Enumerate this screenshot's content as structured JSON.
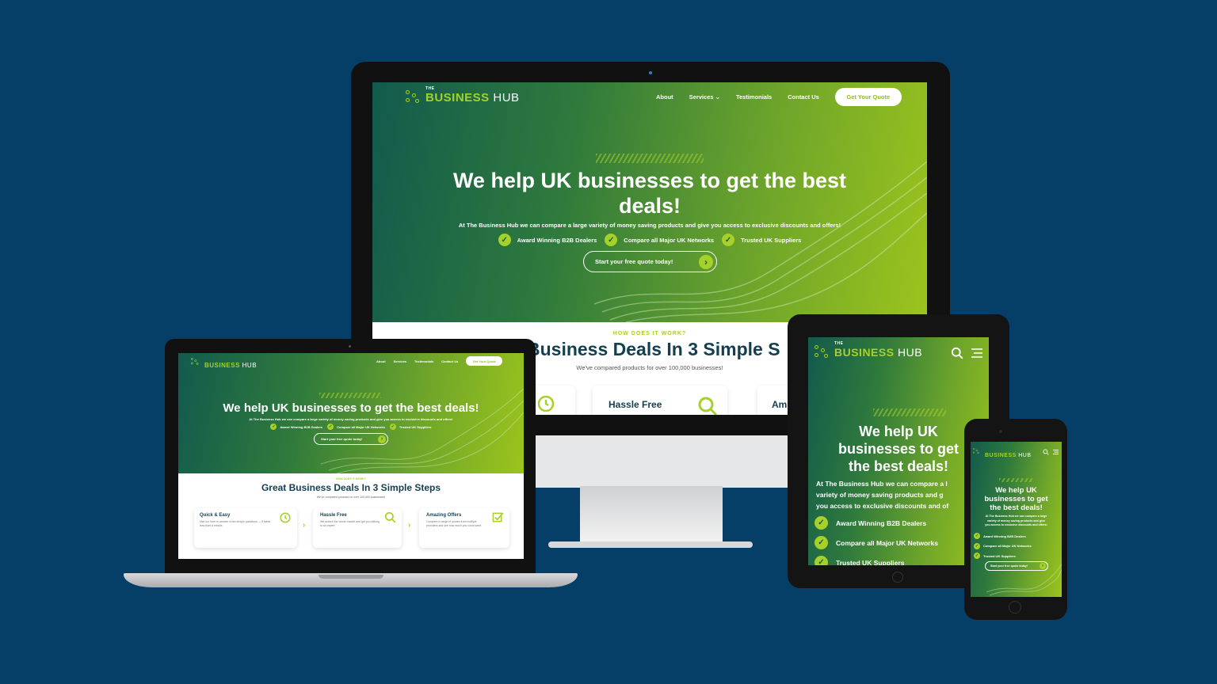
{
  "brand": {
    "the": "THE",
    "business": "BUSINESS",
    "hub": "HUB"
  },
  "nav": {
    "about": "About",
    "services": "Services",
    "services_caret": "⌄",
    "testimonials": "Testimonials",
    "contact": "Contact Us",
    "quote": "Get Your Quote"
  },
  "hero": {
    "title_full": "We help UK businesses to get the best deals!",
    "desktop_title_line1": "We help UK businesses to get the best",
    "desktop_title_line2": "deals!",
    "tablet_title_line1": "We help UK",
    "tablet_title_line2": "businesses to get",
    "tablet_title_line3": "the best deals!",
    "phone_title_line1": "We help UK",
    "phone_title_line2": "businesses to get",
    "phone_title_line3": "the best deals!",
    "subtitle": "At The Business Hub we can compare a large variety of money saving products and give you access to exclusive discounts and offers!",
    "tablet_sub_line1": "At The Business Hub we can compare a l",
    "tablet_sub_line2": "variety of money saving products and g",
    "tablet_sub_line3": "you access to exclusive discounts and of",
    "phone_sub_line1": "At The Business Hub we can compare a large",
    "phone_sub_line2": "variety of money saving products and give",
    "phone_sub_line3": "you access to exclusive discounts and offers!",
    "check_mark": "✓",
    "bullets": [
      "Award Winning B2B Dealers",
      "Compare all Major UK Networks",
      "Trusted UK Suppliers"
    ],
    "cta": "Start your free quote today!",
    "cta_arrow": "›"
  },
  "steps": {
    "eyebrow": "HOW DOES IT WORK?",
    "title": "Great Business Deals In 3 Simple Steps",
    "desktop_title_visible": "Business Deals In 3 Simple S",
    "subtitle": "We've compared products for over 100,000 businesses!",
    "next_arrow": "›",
    "cards": [
      {
        "title": "Quick & Easy",
        "text": "Use our form to answer a few simple questions — it takes less than a minute.",
        "icon": "clock-icon"
      },
      {
        "title": "Hassle Free",
        "text": "We search the whole market and get you talking to an expert.",
        "icon": "search-icon"
      },
      {
        "title": "Amazing Offers",
        "text": "Compare a range of quotes from multiple providers and see how much you could save.",
        "icon": "checkbox-icon"
      }
    ],
    "desktop_card3_partial": "Am"
  },
  "colors": {
    "background": "#053e66",
    "lime": "#a6d12a",
    "dark_green": "#125a4d",
    "navy_text": "#123f52"
  }
}
